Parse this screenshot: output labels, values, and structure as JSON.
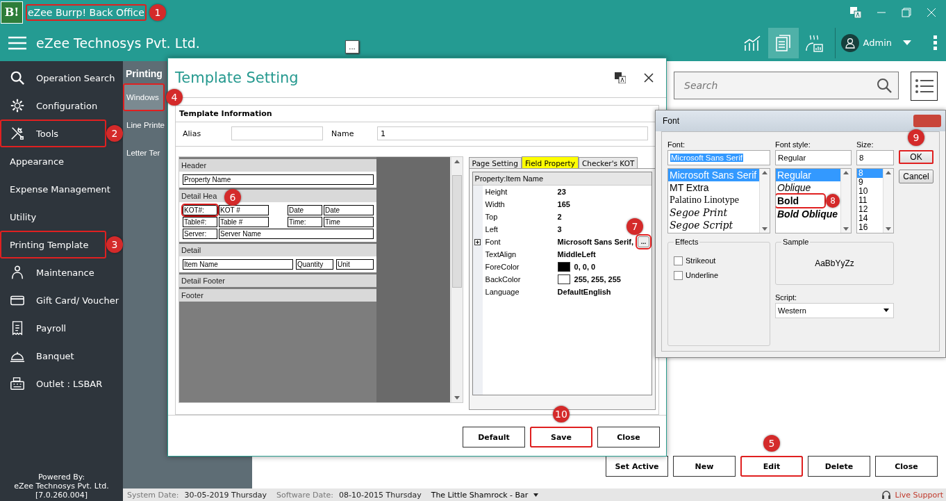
{
  "app_title": {
    "text": "eZee Burrp! Back Office",
    "callout": "1"
  },
  "logo": "B!",
  "company": "eZee Technosys Pvt. Ltd.",
  "float_button": "...",
  "toolbar": [
    {
      "kind": "chart",
      "selected": false
    },
    {
      "kind": "documents",
      "selected": true
    },
    {
      "kind": "steam",
      "selected": false
    }
  ],
  "user": "Admin",
  "sidebar": {
    "items": [
      {
        "label": "Operation Search",
        "kind": "search"
      },
      {
        "label": "Configuration",
        "kind": "gear"
      },
      {
        "label": "Tools",
        "kind": "tools",
        "callout": "2"
      },
      {
        "label": "Appearance",
        "kind": "plain"
      },
      {
        "label": "Expense Management",
        "kind": "plain"
      },
      {
        "label": "Utility",
        "kind": "plain"
      },
      {
        "label": "Printing Template",
        "kind": "plain",
        "callout": "3"
      },
      {
        "label": "Maintenance",
        "kind": "worker"
      },
      {
        "label": "Gift Card/ Voucher",
        "kind": "card"
      },
      {
        "label": "Payroll",
        "kind": "receipt"
      },
      {
        "label": "Banquet",
        "kind": "cloche"
      },
      {
        "label": "Outlet : LSBAR",
        "kind": "register"
      }
    ],
    "footer": [
      "Powered By:",
      "eZee Technosys Pvt. Ltd.",
      "[7.0.260.004]"
    ]
  },
  "submenu": {
    "title": "Printing",
    "items": [
      {
        "label": "Windows",
        "selected": true,
        "callout": "4"
      },
      {
        "label": "Line Printe",
        "selected": false
      },
      {
        "label": "Letter Ter",
        "selected": false
      }
    ]
  },
  "main": {
    "search": {
      "placeholder": "Search"
    },
    "buttons": [
      {
        "label": "Set Active"
      },
      {
        "label": "New"
      },
      {
        "label": "Edit",
        "callout": "5"
      },
      {
        "label": "Delete"
      },
      {
        "label": "Close"
      }
    ]
  },
  "status_bar": {
    "items": [
      {
        "label": "System Date:",
        "value": "30-05-2019 Thursday"
      },
      {
        "label": "Software Date:",
        "value": "08-10-2015 Thursday"
      }
    ],
    "outlet": "The Little Shamrock - Bar",
    "support": "Live Support"
  },
  "template_dialog": {
    "title": "Template Setting",
    "section": "Template Information",
    "fields": [
      {
        "label": "Alias"
      },
      {
        "label": "Name",
        "value": "1"
      }
    ],
    "bands": [
      {
        "title": "Header",
        "rows": [
          [
            {
              "text": "Property Name"
            }
          ]
        ]
      },
      {
        "title": "Detail Hea",
        "rows": [
          [
            {
              "text": "KOT#:",
              "callout": "6"
            },
            {
              "text": "KOT #"
            },
            {
              "text": "Date"
            },
            {
              "text": "Date"
            }
          ],
          [
            {
              "text": "Table#:"
            },
            {
              "text": "Table #"
            },
            {
              "text": "Time:"
            },
            {
              "text": "Time"
            }
          ],
          [
            {
              "text": "Server:"
            },
            {
              "text": "Server Name"
            }
          ]
        ]
      },
      {
        "title": "Detail",
        "rows": [
          [
            {
              "text": "Item Name"
            },
            {
              "text": "Quantity"
            },
            {
              "text": "Unit"
            }
          ]
        ]
      },
      {
        "title": "Detail Footer"
      },
      {
        "title": "Footer"
      }
    ],
    "tabs": [
      {
        "label": "Page Setting",
        "selected": false
      },
      {
        "label": "Field Property",
        "selected": true
      },
      {
        "label": "Checker's KOT",
        "selected": false
      }
    ],
    "property_header": "Property:Item Name",
    "properties": [
      {
        "kind": "text",
        "name": "Height",
        "value": "23"
      },
      {
        "kind": "text",
        "name": "Width",
        "value": "165"
      },
      {
        "kind": "text",
        "name": "Top",
        "value": "2"
      },
      {
        "kind": "text",
        "name": "Left",
        "value": "3"
      },
      {
        "kind": "font",
        "name": "Font",
        "value": "Microsoft Sans Serif,",
        "button": "...",
        "callout": "7"
      },
      {
        "kind": "text",
        "name": "TextAlign",
        "value": "MiddleLeft"
      },
      {
        "kind": "color",
        "name": "ForeColor",
        "color": "#000000",
        "value": "0, 0, 0"
      },
      {
        "kind": "color",
        "name": "BackColor",
        "color": "#ffffff",
        "value": "255, 255, 255"
      },
      {
        "kind": "text",
        "name": "Language",
        "value": "DefaultEnglish"
      }
    ],
    "buttons": [
      {
        "label": "Default"
      },
      {
        "label": "Save",
        "callout": "10"
      },
      {
        "label": "Close"
      }
    ]
  },
  "font_dialog": {
    "title": "Font",
    "font": {
      "label": "Font:",
      "value": "Microsoft Sans Serif",
      "items": [
        {
          "text": "Microsoft Sans Serif",
          "kind": "sans",
          "selected": true
        },
        {
          "text": "MT Extra",
          "kind": "sans",
          "selected": false
        },
        {
          "text": "Palatino Linotype",
          "kind": "serif",
          "selected": false
        },
        {
          "text": "Segoe Print",
          "kind": "script",
          "selected": false
        },
        {
          "text": "Segoe Script",
          "kind": "script",
          "selected": false
        }
      ]
    },
    "style": {
      "label": "Font style:",
      "value": "Regular",
      "items": [
        {
          "text": "Regular",
          "kind": "regular",
          "selected": true
        },
        {
          "text": "Oblique",
          "kind": "oblique",
          "selected": false
        },
        {
          "text": "Bold",
          "kind": "bold",
          "selected": false,
          "callout": "8"
        },
        {
          "text": "Bold Oblique",
          "kind": "bold-oblique",
          "selected": false
        }
      ]
    },
    "size": {
      "label": "Size:",
      "value": "8",
      "items": [
        {
          "text": "8",
          "selected": true
        },
        {
          "text": "9",
          "selected": false
        },
        {
          "text": "10",
          "selected": false
        },
        {
          "text": "11",
          "selected": false
        },
        {
          "text": "12",
          "selected": false
        },
        {
          "text": "14",
          "selected": false
        },
        {
          "text": "16",
          "selected": false
        }
      ]
    },
    "buttons": [
      {
        "label": "OK",
        "callout": "9"
      },
      {
        "label": "Cancel"
      }
    ],
    "effects": {
      "title": "Effects",
      "options": [
        {
          "label": "Strikeout",
          "checked": false
        },
        {
          "label": "Underline",
          "checked": false
        }
      ]
    },
    "sample": {
      "title": "Sample",
      "text": "AaBbYyZz"
    },
    "script": {
      "label": "Script:",
      "value": "Western"
    }
  }
}
